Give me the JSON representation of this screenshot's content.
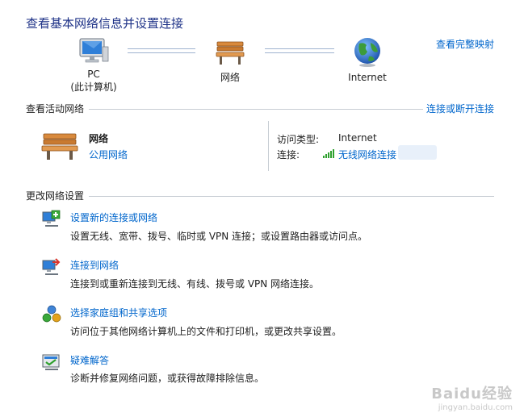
{
  "title": "查看基本网络信息并设置连接",
  "map_link": "查看完整映射",
  "nodes": {
    "pc": {
      "line1": "PC",
      "line2": "(此计算机)",
      "icon": "computer-icon"
    },
    "network": {
      "label": "网络",
      "icon": "bench-icon"
    },
    "internet": {
      "label": "Internet",
      "icon": "globe-icon"
    }
  },
  "active": {
    "heading": "查看活动网络",
    "connect_link": "连接或断开连接",
    "network_name": "网络",
    "network_type": "公用网络",
    "access_type_label": "访问类型:",
    "access_type_value": "Internet",
    "connection_label": "连接:",
    "connection_value": "无线网络连接"
  },
  "settings": {
    "heading": "更改网络设置",
    "tasks": [
      {
        "title": "设置新的连接或网络",
        "desc": "设置无线、宽带、拨号、临时或 VPN 连接；或设置路由器或访问点。",
        "icon": "new-connection-icon"
      },
      {
        "title": "连接到网络",
        "desc": "连接到或重新连接到无线、有线、拨号或 VPN 网络连接。",
        "icon": "connect-network-icon"
      },
      {
        "title": "选择家庭组和共享选项",
        "desc": "访问位于其他网络计算机上的文件和打印机，或更改共享设置。",
        "icon": "homegroup-icon"
      },
      {
        "title": "疑难解答",
        "desc": "诊断并修复网络问题，或获得故障排除信息。",
        "icon": "troubleshoot-icon"
      }
    ]
  },
  "watermark": {
    "main": "Baidu经验",
    "url": "jingyan.baidu.com"
  },
  "colors": {
    "title": "#1e3287",
    "link": "#0066cc",
    "rule": "#c7cdd4",
    "signal": "#2ea02e"
  }
}
